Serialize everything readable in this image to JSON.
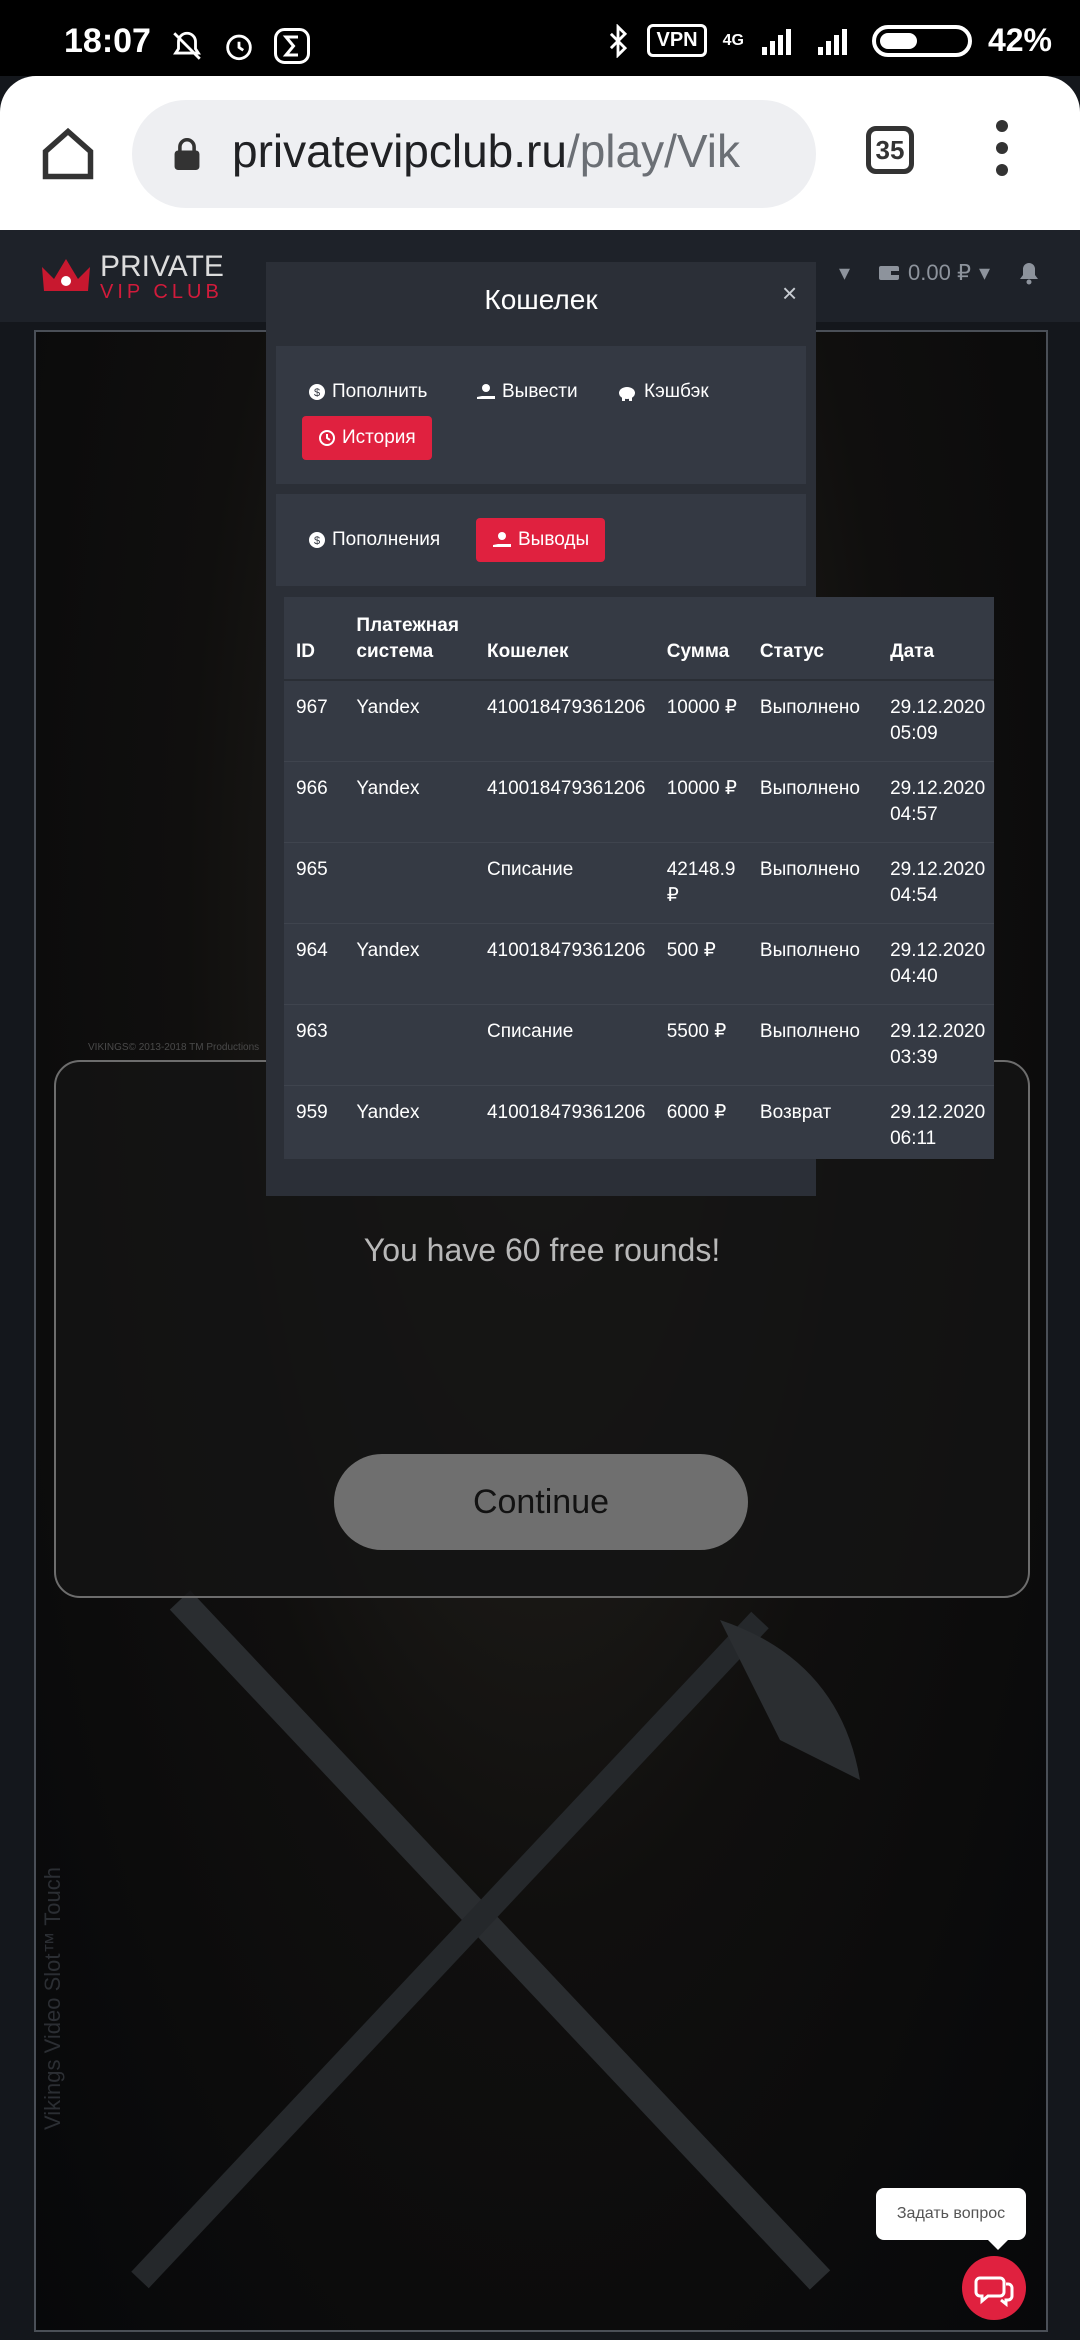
{
  "status_bar": {
    "time": "18:07",
    "vpn": "VPN",
    "network": "4G",
    "battery": "42%"
  },
  "browser": {
    "url_domain": "privatevipclub.ru",
    "url_path": "/play/Vik",
    "tab_count": "35"
  },
  "site_header": {
    "logo_line1": "PRIVATE",
    "logo_line2": "VIP CLUB",
    "balance": "0.00 ₽"
  },
  "modal": {
    "title": "Кошелек",
    "close": "×",
    "tabs": [
      {
        "label": "Пополнить"
      },
      {
        "label": "Вывести"
      },
      {
        "label": "Кэшбэк"
      },
      {
        "label": "История"
      }
    ],
    "subtabs": [
      {
        "label": "Пополнения"
      },
      {
        "label": "Выводы"
      }
    ],
    "table": {
      "headers": [
        "ID",
        "Платежная система",
        "Кошелек",
        "Сумма",
        "Статус",
        "Дата"
      ],
      "rows": [
        [
          "967",
          "Yandex",
          "410018479361206",
          "10000 ₽",
          "Выполнено",
          "29.12.2020 05:09"
        ],
        [
          "966",
          "Yandex",
          "410018479361206",
          "10000 ₽",
          "Выполнено",
          "29.12.2020 04:57"
        ],
        [
          "965",
          "",
          "Списание",
          "42148.9 ₽",
          "Выполнено",
          "29.12.2020 04:54"
        ],
        [
          "964",
          "Yandex",
          "410018479361206",
          "500 ₽",
          "Выполнено",
          "29.12.2020 04:40"
        ],
        [
          "963",
          "",
          "Списание",
          "5500 ₽",
          "Выполнено",
          "29.12.2020 03:39"
        ],
        [
          "959",
          "Yandex",
          "410018479361206",
          "6000 ₽",
          "Возврат",
          "29.12.2020 06:11"
        ]
      ]
    }
  },
  "game": {
    "copyright": "VIKINGS© 2013-2018 TM Productions",
    "free_rounds": "You have 60 free rounds!",
    "continue_label": "Continue",
    "side_title": "Vikings Video Slot™ Touch"
  },
  "chat": {
    "bubble": "Задать вопрос"
  },
  "colors": {
    "accent": "#e0213f",
    "modal_bg": "#2b2f37",
    "panel_bg": "#343943"
  }
}
